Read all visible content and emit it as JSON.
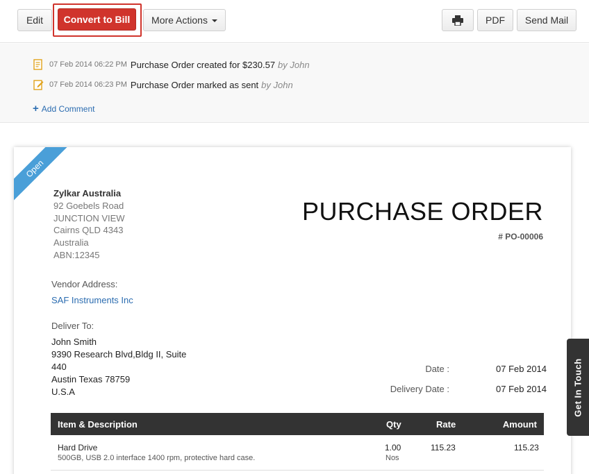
{
  "toolbar": {
    "edit": "Edit",
    "convert": "Convert to Bill",
    "more": "More Actions",
    "pdf": "PDF",
    "send_mail": "Send Mail"
  },
  "activity": [
    {
      "time": "07 Feb 2014 06:22 PM",
      "text": "Purchase Order created for $230.57",
      "by": "by John",
      "icon": "document-icon"
    },
    {
      "time": "07 Feb 2014 06:23 PM",
      "text": "Purchase Order marked as sent",
      "by": "by John",
      "icon": "edit-icon"
    }
  ],
  "add_comment": "Add Comment",
  "status_ribbon": "Open",
  "company": {
    "name": "Zylkar Australia",
    "lines": [
      "92 Goebels Road",
      "JUNCTION VIEW",
      "Cairns QLD 4343",
      "Australia",
      "ABN:12345"
    ]
  },
  "document": {
    "title": "PURCHASE ORDER",
    "number": "# PO-00006"
  },
  "vendor": {
    "label": "Vendor Address:",
    "name": "SAF Instruments Inc"
  },
  "deliver": {
    "label": "Deliver To:",
    "lines": [
      "John Smith",
      "9390 Research Blvd,Bldg II, Suite",
      "440",
      "Austin Texas 78759",
      "U.S.A"
    ]
  },
  "meta": {
    "date_label": "Date :",
    "date_value": "07 Feb 2014",
    "delivery_label": "Delivery Date :",
    "delivery_value": "07 Feb 2014"
  },
  "table": {
    "headers": {
      "item": "Item & Description",
      "qty": "Qty",
      "rate": "Rate",
      "amount": "Amount"
    },
    "rows": [
      {
        "item": "Hard Drive",
        "desc": "500GB, USB 2.0 interface 1400 rpm, protective hard case.",
        "qty": "1.00",
        "unit": "Nos",
        "rate": "115.23",
        "amount": "115.23"
      }
    ]
  },
  "get_in_touch": "Get In Touch",
  "colors": {
    "accent_red": "#d0342c",
    "link_blue": "#2b6cb0",
    "ribbon_blue": "#4a9fd8"
  }
}
